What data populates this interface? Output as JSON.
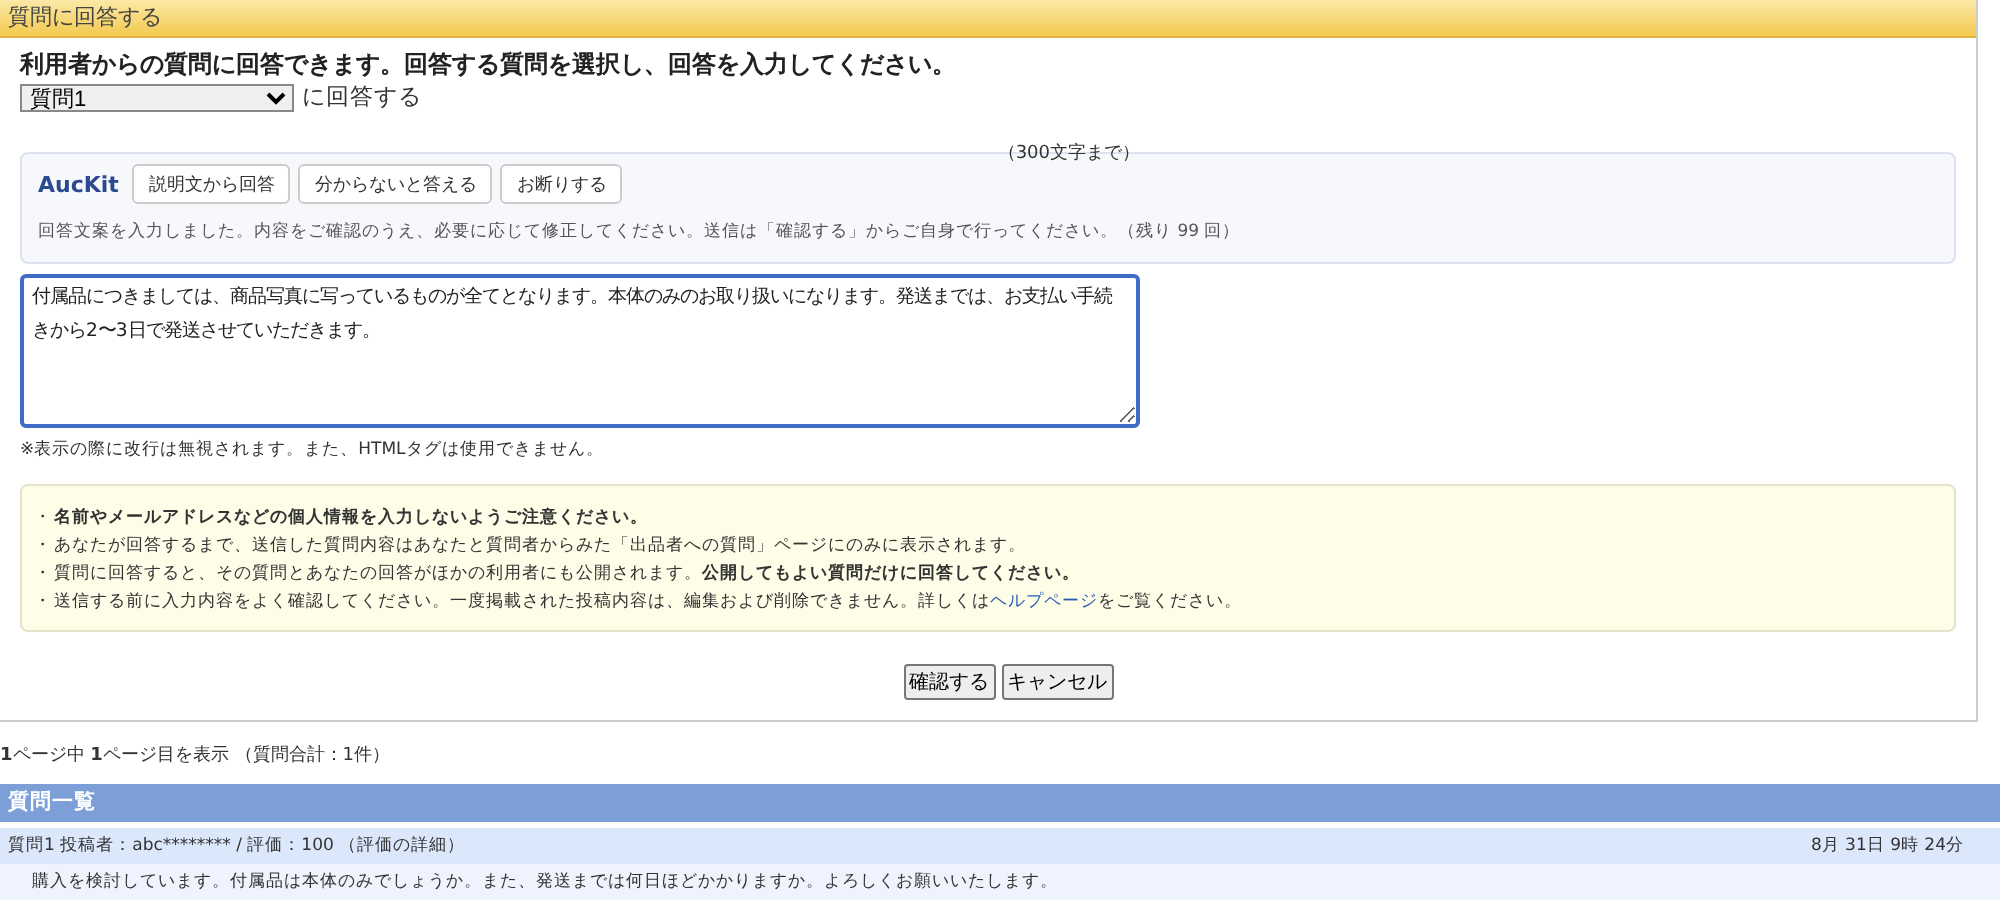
{
  "window": {
    "title": "質問に回答する"
  },
  "intro": "利用者からの質問に回答できます。回答する質問を選択し、回答を入力してください。",
  "question_select": {
    "value": "質問1",
    "suffix": "に回答する"
  },
  "char_limit": "（300文字まで）",
  "auckit": {
    "brand": "AucKit",
    "buttons": [
      "説明文から回答",
      "分からないと答える",
      "お断りする"
    ],
    "status": "回答文案を入力しました。内容をご確認のうえ、必要に応じて修正してください。送信は「確認する」からご自身で行ってください。（残り 99 回）"
  },
  "answer": {
    "value": "付属品につきましては、商品写真に写っているものが全てとなります。本体のみのお取り扱いになります。発送までは、お支払い手続きから2〜3日で発送させていただきます。"
  },
  "answer_note": "※表示の際に改行は無視されます。また、HTMLタグは使用できません。",
  "notices": [
    {
      "bullet": "・",
      "bold": true,
      "text": "名前やメールアドレスなどの個人情報を入力しないようご注意ください。"
    },
    {
      "bullet": "・",
      "bold": false,
      "text": "あなたが回答するまで、送信した質問内容はあなたと質問者からみた「出品者への質問」ページにのみに表示されます。"
    },
    {
      "bullet": "・",
      "bold": false,
      "text": "質問に回答すると、その質問とあなたの回答がほかの利用者にも公開されます。**公開してもよい質問だけに回答してください。**"
    },
    {
      "bullet": "・",
      "bold": false,
      "text": "送信する前に入力内容をよく確認してください。一度掲載された投稿内容は、編集および削除できません。詳しくは",
      "link": "ヘルプページ",
      "after": "をご覧ください。"
    }
  ],
  "buttons": [
    "確認する",
    "キャンセル"
  ],
  "pagination": "**1**ページ中 **1**ページ目を表示 （質問合計：1件）",
  "question_list": {
    "title": "質問一覧",
    "items": [
      {
        "meta": "質問1 投稿者：abc******** / 評価：100 （評価の詳細）",
        "date": "8月 31日 9時 24分",
        "body": "購入を検討しています。付属品は本体のみでしょうか。また、発送までは何日ほどかかりますか。よろしくお願いいたします。"
      }
    ]
  }
}
